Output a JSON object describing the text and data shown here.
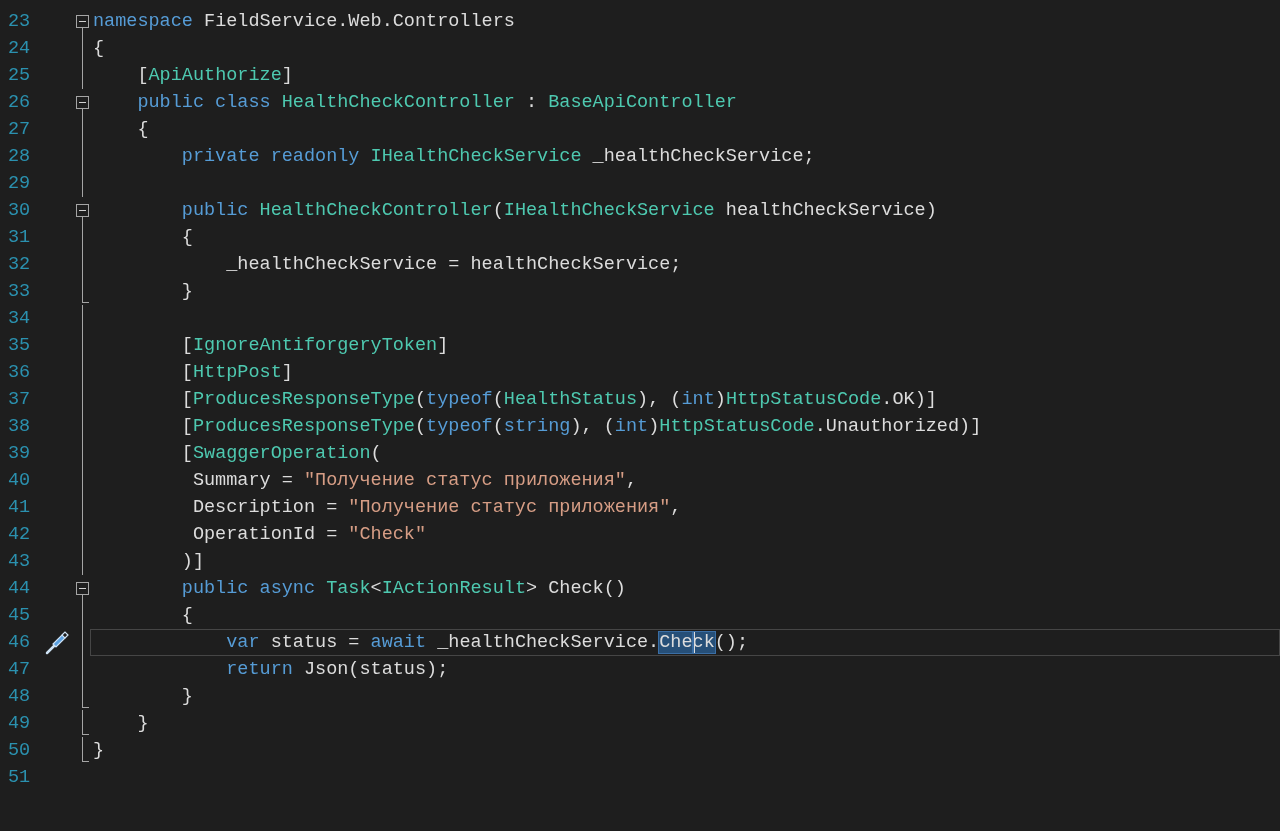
{
  "editor": {
    "lines": [
      {
        "number": "23",
        "kind": "fold_start",
        "current": false,
        "quick_action": false,
        "tokens": [
          {
            "kind": "keyword",
            "text": "namespace"
          },
          {
            "kind": "plain",
            "text": " FieldService.Web.Controllers"
          }
        ]
      },
      {
        "number": "24",
        "kind": "fold_inner",
        "current": false,
        "quick_action": false,
        "tokens": [
          {
            "kind": "plain",
            "text": "{"
          }
        ]
      },
      {
        "number": "25",
        "kind": "fold_inner",
        "current": false,
        "quick_action": false,
        "tokens": [
          {
            "kind": "plain",
            "text": "    ["
          },
          {
            "kind": "type",
            "text": "ApiAuthorize"
          },
          {
            "kind": "plain",
            "text": "]"
          }
        ]
      },
      {
        "number": "26",
        "kind": "fold_start",
        "current": false,
        "quick_action": false,
        "tokens": [
          {
            "kind": "keyword",
            "text": "    public class "
          },
          {
            "kind": "type",
            "text": "HealthCheckController"
          },
          {
            "kind": "plain",
            "text": " : "
          },
          {
            "kind": "type",
            "text": "BaseApiController"
          }
        ]
      },
      {
        "number": "27",
        "kind": "fold_inner",
        "current": false,
        "quick_action": false,
        "tokens": [
          {
            "kind": "plain",
            "text": "    {"
          }
        ]
      },
      {
        "number": "28",
        "kind": "fold_inner",
        "current": false,
        "quick_action": false,
        "tokens": [
          {
            "kind": "keyword",
            "text": "        private readonly "
          },
          {
            "kind": "type",
            "text": "IHealthCheckService"
          },
          {
            "kind": "plain",
            "text": " _healthCheckService;"
          }
        ]
      },
      {
        "number": "29",
        "kind": "fold_inner",
        "current": false,
        "quick_action": false
      },
      {
        "number": "30",
        "kind": "fold_start",
        "current": false,
        "quick_action": false,
        "tokens": [
          {
            "kind": "keyword",
            "text": "        public "
          },
          {
            "kind": "type",
            "text": "HealthCheckController"
          },
          {
            "kind": "plain",
            "text": "("
          },
          {
            "kind": "type",
            "text": "IHealthCheckService"
          },
          {
            "kind": "plain",
            "text": " healthCheckService)"
          }
        ]
      },
      {
        "number": "31",
        "kind": "fold_inner",
        "current": false,
        "quick_action": false,
        "tokens": [
          {
            "kind": "plain",
            "text": "        {"
          }
        ]
      },
      {
        "number": "32",
        "kind": "fold_inner",
        "current": false,
        "quick_action": false,
        "tokens": [
          {
            "kind": "plain",
            "text": "            _healthCheckService = healthCheckService;"
          }
        ]
      },
      {
        "number": "33",
        "kind": "fold_end",
        "current": false,
        "quick_action": false,
        "tokens": [
          {
            "kind": "plain",
            "text": "        }"
          }
        ]
      },
      {
        "number": "34",
        "kind": "fold_inner",
        "current": false,
        "quick_action": false
      },
      {
        "number": "35",
        "kind": "fold_inner",
        "current": false,
        "quick_action": false,
        "tokens": [
          {
            "kind": "plain",
            "text": "        ["
          },
          {
            "kind": "type",
            "text": "IgnoreAntiforgeryToken"
          },
          {
            "kind": "plain",
            "text": "]"
          }
        ]
      },
      {
        "number": "36",
        "kind": "fold_inner",
        "current": false,
        "quick_action": false,
        "tokens": [
          {
            "kind": "plain",
            "text": "        ["
          },
          {
            "kind": "type",
            "text": "HttpPost"
          },
          {
            "kind": "plain",
            "text": "]"
          }
        ]
      },
      {
        "number": "37",
        "kind": "fold_inner",
        "current": false,
        "quick_action": false,
        "tokens": [
          {
            "kind": "plain",
            "text": "        ["
          },
          {
            "kind": "type",
            "text": "ProducesResponseType"
          },
          {
            "kind": "plain",
            "text": "("
          },
          {
            "kind": "keyword",
            "text": "typeof"
          },
          {
            "kind": "plain",
            "text": "("
          },
          {
            "kind": "type",
            "text": "HealthStatus"
          },
          {
            "kind": "plain",
            "text": "), ("
          },
          {
            "kind": "keyword",
            "text": "int"
          },
          {
            "kind": "plain",
            "text": ")"
          },
          {
            "kind": "type",
            "text": "HttpStatusCode"
          },
          {
            "kind": "plain",
            "text": ".OK)]"
          }
        ]
      },
      {
        "number": "38",
        "kind": "fold_inner",
        "current": false,
        "quick_action": false,
        "tokens": [
          {
            "kind": "plain",
            "text": "        ["
          },
          {
            "kind": "type",
            "text": "ProducesResponseType"
          },
          {
            "kind": "plain",
            "text": "("
          },
          {
            "kind": "keyword",
            "text": "typeof"
          },
          {
            "kind": "plain",
            "text": "("
          },
          {
            "kind": "keyword",
            "text": "string"
          },
          {
            "kind": "plain",
            "text": "), ("
          },
          {
            "kind": "keyword",
            "text": "int"
          },
          {
            "kind": "plain",
            "text": ")"
          },
          {
            "kind": "type",
            "text": "HttpStatusCode"
          },
          {
            "kind": "plain",
            "text": ".Unauthorized)]"
          }
        ]
      },
      {
        "number": "39",
        "kind": "fold_inner",
        "current": false,
        "quick_action": false,
        "tokens": [
          {
            "kind": "plain",
            "text": "        ["
          },
          {
            "kind": "type",
            "text": "SwaggerOperation"
          },
          {
            "kind": "plain",
            "text": "("
          }
        ]
      },
      {
        "number": "40",
        "kind": "fold_inner",
        "current": false,
        "quick_action": false,
        "tokens": [
          {
            "kind": "plain",
            "text": "         Summary = "
          },
          {
            "kind": "string",
            "text": "\"Получение статус приложения\""
          },
          {
            "kind": "plain",
            "text": ","
          }
        ]
      },
      {
        "number": "41",
        "kind": "fold_inner",
        "current": false,
        "quick_action": false,
        "tokens": [
          {
            "kind": "plain",
            "text": "         Description = "
          },
          {
            "kind": "string",
            "text": "\"Получение статус приложения\""
          },
          {
            "kind": "plain",
            "text": ","
          }
        ]
      },
      {
        "number": "42",
        "kind": "fold_inner",
        "current": false,
        "quick_action": false,
        "tokens": [
          {
            "kind": "plain",
            "text": "         OperationId = "
          },
          {
            "kind": "string",
            "text": "\"Check\""
          }
        ]
      },
      {
        "number": "43",
        "kind": "fold_inner",
        "current": false,
        "quick_action": false,
        "tokens": [
          {
            "kind": "plain",
            "text": "        )]"
          }
        ]
      },
      {
        "number": "44",
        "kind": "fold_start",
        "current": false,
        "quick_action": false,
        "tokens": [
          {
            "kind": "keyword",
            "text": "        public async "
          },
          {
            "kind": "type",
            "text": "Task"
          },
          {
            "kind": "plain",
            "text": "<"
          },
          {
            "kind": "type",
            "text": "IActionResult"
          },
          {
            "kind": "plain",
            "text": "> Check()"
          }
        ]
      },
      {
        "number": "45",
        "kind": "fold_inner",
        "current": false,
        "quick_action": false,
        "tokens": [
          {
            "kind": "plain",
            "text": "        {"
          }
        ]
      },
      {
        "number": "46",
        "kind": "fold_inner",
        "current": true,
        "quick_action": true,
        "tokens": [
          {
            "kind": "keyword",
            "text": "            var"
          },
          {
            "kind": "plain",
            "text": " status = "
          },
          {
            "kind": "keyword",
            "text": "await"
          },
          {
            "kind": "plain",
            "text": " _healthCheckService."
          },
          {
            "kind": "selection",
            "text": "Che"
          },
          {
            "kind": "selection_after_caret",
            "text": "ck"
          },
          {
            "kind": "plain",
            "text": "();"
          }
        ]
      },
      {
        "number": "47",
        "kind": "fold_inner",
        "current": false,
        "quick_action": false,
        "tokens": [
          {
            "kind": "keyword",
            "text": "            return"
          },
          {
            "kind": "plain",
            "text": " Json(status);"
          }
        ]
      },
      {
        "number": "48",
        "kind": "fold_end",
        "current": false,
        "quick_action": false,
        "tokens": [
          {
            "kind": "plain",
            "text": "        }"
          }
        ]
      },
      {
        "number": "49",
        "kind": "fold_end",
        "current": false,
        "quick_action": false,
        "tokens": [
          {
            "kind": "plain",
            "text": "    }"
          }
        ]
      },
      {
        "number": "50",
        "kind": "fold_end",
        "current": false,
        "quick_action": false,
        "tokens": [
          {
            "kind": "plain",
            "text": "}"
          }
        ]
      },
      {
        "number": "51",
        "kind": "plain",
        "current": false,
        "quick_action": false
      }
    ]
  }
}
